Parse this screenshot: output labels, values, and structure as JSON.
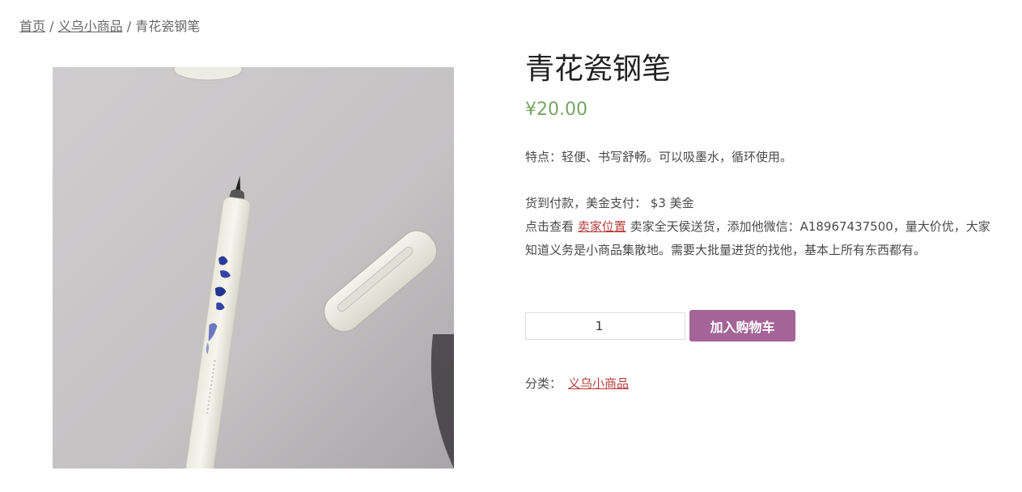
{
  "breadcrumb": {
    "home": "首页",
    "sep1": "/",
    "category": "义乌小商品",
    "sep2": "/",
    "current": "青花瓷钢笔"
  },
  "product": {
    "title": "青花瓷钢笔",
    "price": "¥20.00",
    "features": "特点：轻便、书写舒畅。可以吸墨水，循环使用。",
    "payment": "货到付款，美金支付： $3 美金",
    "contact_prefix": "点击查看 ",
    "contact_link": "卖家位置",
    "contact_suffix": " 卖家全天侯送货，添加他微信：A18967437500，量大价优，大家知道义务是小商品集散地。需要大批量进货的找他，基本上所有东西都有。",
    "quantity": "1",
    "add_to_cart": "加入购物车",
    "category_label": "分类：",
    "category_link": "义乌小商品",
    "image_icon": "fountain-pen-photo"
  },
  "colors": {
    "price": "#77a464",
    "button": "#a46497",
    "link": "#b73b3b"
  }
}
